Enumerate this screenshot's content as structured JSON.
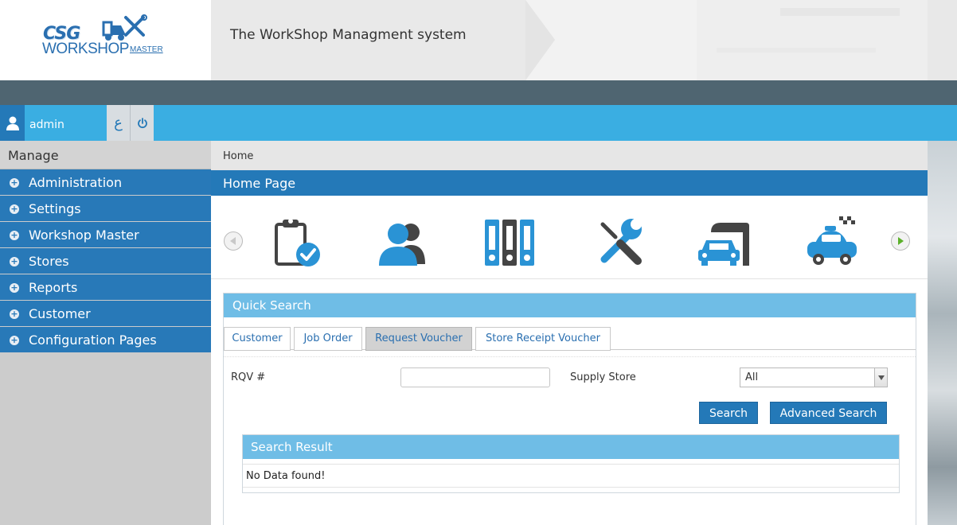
{
  "header": {
    "logo": {
      "csg": "CSG",
      "workshop": "WORKSHOP",
      "master": "MASTER"
    },
    "title": "The WorkShop Managment system"
  },
  "userbar": {
    "username": "admin",
    "language_toggle": "ع"
  },
  "sidebar": {
    "title": "Manage",
    "items": [
      {
        "label": "Administration"
      },
      {
        "label": "Settings"
      },
      {
        "label": "Workshop Master"
      },
      {
        "label": "Stores"
      },
      {
        "label": "Reports"
      },
      {
        "label": "Customer"
      },
      {
        "label": "Configuration Pages"
      }
    ]
  },
  "main": {
    "breadcrumb": "Home",
    "page_title": "Home Page",
    "carousel_icons": [
      "clipboard-check-icon",
      "users-icon",
      "binders-icon",
      "tools-icon",
      "car-garage-icon",
      "taxi-icon"
    ],
    "quick_search": {
      "title": "Quick Search",
      "tabs": [
        "Customer",
        "Job Order",
        "Request Voucher",
        "Store Receipt Voucher"
      ],
      "active_tab": "Request Voucher",
      "fields": {
        "rqv_label": "RQV #",
        "rqv_value": "",
        "supply_store_label": "Supply Store",
        "supply_store_value": "All"
      },
      "buttons": {
        "search": "Search",
        "advanced": "Advanced Search"
      }
    },
    "search_result": {
      "title": "Search Result",
      "message": "No Data found!"
    }
  },
  "colors": {
    "primary": "#2479b8",
    "accent_light": "#6fbde6",
    "userbar": "#3aaee2",
    "dark_bar": "#4f6571"
  }
}
